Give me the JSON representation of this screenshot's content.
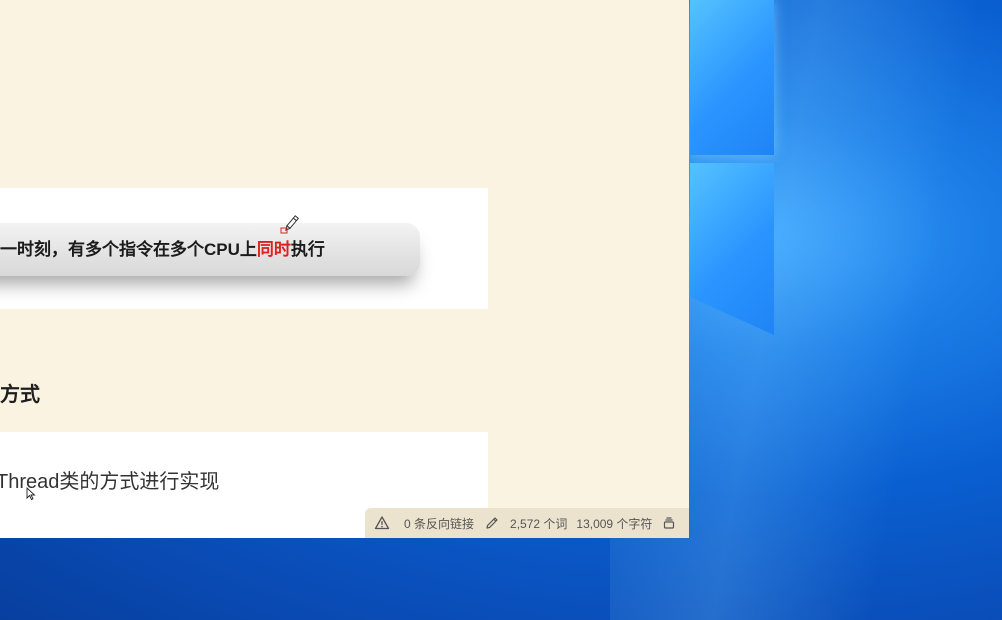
{
  "desktop": {
    "wallpaper": "windows-10-hero",
    "colors": {
      "primary": "#0a5fd0",
      "glow": "#55c2ff"
    }
  },
  "editor": {
    "background": "#faf3e2",
    "image_card_1": {
      "caption_prefix": "一时刻，有多个指令在多个CPU上",
      "caption_highlight": "同时",
      "caption_suffix": "执行",
      "highlight_color": "#d9241b"
    },
    "section_heading": "方式",
    "image_card_2": {
      "text": "Thread类的方式进行实现"
    }
  },
  "status_bar": {
    "warning_icon": "warning-triangle-icon",
    "backlinks": "0 条反向链接",
    "edit_icon": "pencil-icon",
    "word_count": "2,572 个词",
    "char_count": "13,009 个字符",
    "sync_icon": "stack-icon"
  }
}
